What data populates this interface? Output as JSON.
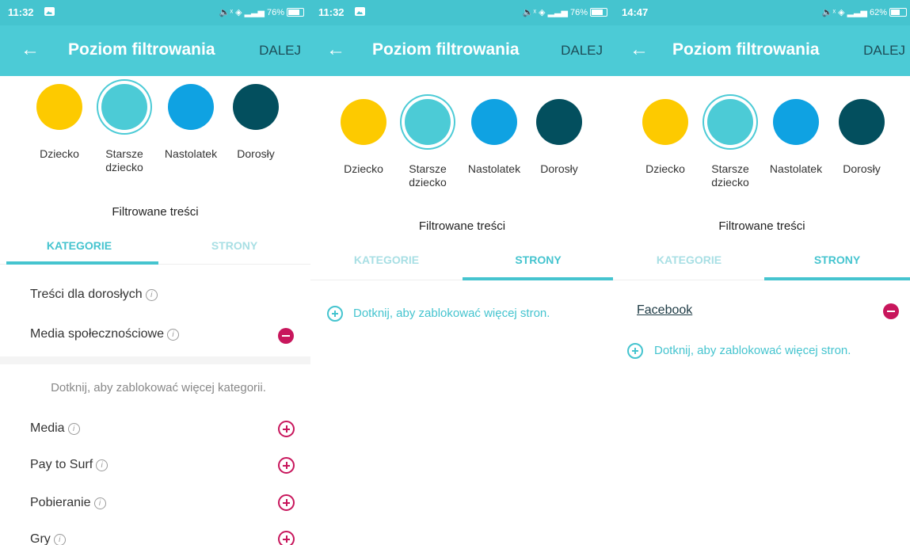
{
  "colors": {
    "accent": "#45c4cf",
    "danger": "#c8165c",
    "yellow": "#fdca00",
    "blue": "#0fa2e2",
    "dark": "#034f5e"
  },
  "screens": [
    {
      "status": {
        "time": "11:32",
        "battery": "76%"
      },
      "appbar": {
        "title": "Poziom filtrowania",
        "next": "DALEJ"
      }
    },
    {
      "status": {
        "time": "11:32",
        "battery": "76%"
      },
      "appbar": {
        "title": "Poziom filtrowania",
        "next": "DALEJ"
      }
    },
    {
      "status": {
        "time": "14:47",
        "battery": "62%"
      },
      "appbar": {
        "title": "Poziom filtrowania",
        "next": "DALEJ"
      }
    }
  ],
  "levels": {
    "child": "Dziecko",
    "older_child_1": "Starsze",
    "older_child_2": "dziecko",
    "teen": "Nastolatek",
    "adult": "Dorosły",
    "selected": "Starsze dziecko"
  },
  "section_title": "Filtrowane treści",
  "tabs": {
    "categories": "KATEGORIE",
    "sites": "STRONY"
  },
  "categories": {
    "blocked": [
      {
        "label": "Treści dla dorosłych",
        "removable": false
      },
      {
        "label": "Media społecznościowe",
        "removable": true
      }
    ],
    "hint": "Dotknij, aby zablokować więcej kategorii.",
    "available": [
      "Media",
      "Pay to Surf",
      "Pobieranie",
      "Gry"
    ]
  },
  "sites": {
    "add_hint": "Dotknij, aby zablokować więcej stron.",
    "blocked": [
      "Facebook"
    ]
  },
  "icons": {
    "back": "arrow-left-icon",
    "info": "info-icon",
    "remove": "minus-circle-icon",
    "add": "plus-circle-icon"
  }
}
